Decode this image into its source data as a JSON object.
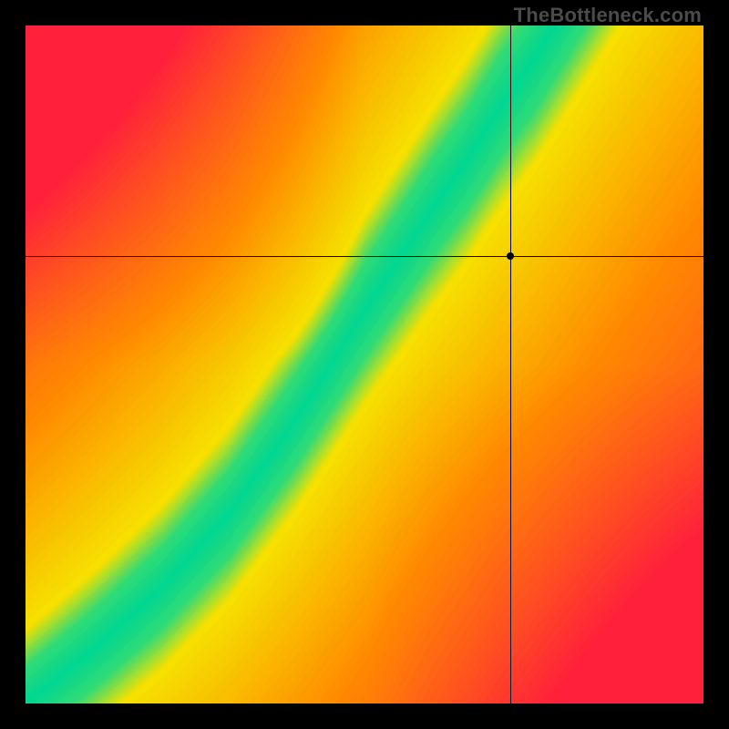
{
  "credit": "TheBottleneck.com",
  "chart_data": {
    "type": "heatmap",
    "title": "",
    "xlabel": "",
    "ylabel": "",
    "xlim": [
      0,
      1
    ],
    "ylim": [
      0,
      1
    ],
    "crosshair": {
      "x": 0.715,
      "y": 0.66
    },
    "marker": {
      "x": 0.715,
      "y": 0.66
    },
    "ridge_curve_x_to_y": [
      [
        0.0,
        0.0
      ],
      [
        0.1,
        0.08
      ],
      [
        0.2,
        0.17
      ],
      [
        0.3,
        0.28
      ],
      [
        0.4,
        0.42
      ],
      [
        0.5,
        0.58
      ],
      [
        0.6,
        0.73
      ],
      [
        0.65,
        0.8
      ],
      [
        0.7,
        0.88
      ],
      [
        0.75,
        0.95
      ],
      [
        0.78,
        1.0
      ]
    ],
    "color_stops": {
      "ridge": "#00d892",
      "near_ridge": "#f5e100",
      "mid": "#ff8a00",
      "far": "#ff1e3c"
    },
    "grid": false,
    "legend": false,
    "description": "Smooth 2D field where a green ridge follows a super-linear curve from bottom-left to upper-mid-right; value falls off through yellow and orange to red with distance from the ridge. Black crosshair lines and a dot mark a point just right of the ridge near the upper third of the plot."
  }
}
